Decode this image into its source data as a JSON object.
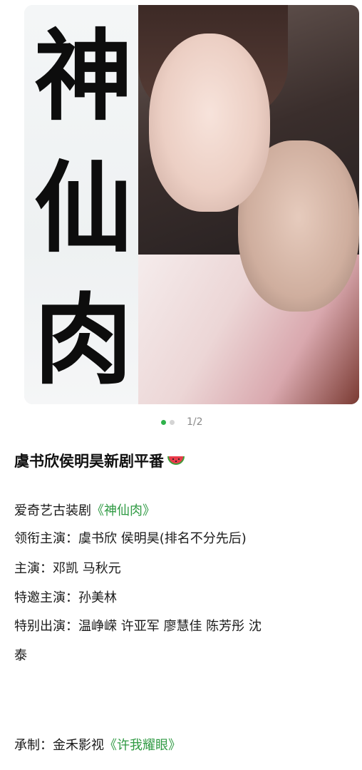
{
  "poster": {
    "calligraphy": [
      "神",
      "仙",
      "肉"
    ],
    "description": ""
  },
  "carousel": {
    "counter": "1/2",
    "current": 1,
    "total": 2
  },
  "post": {
    "title": "虞书欣侯明昊新剧平番",
    "title_emoji": "watermelon-icon",
    "lines": {
      "l1_prefix": "爱奇艺古装剧",
      "l1_link": "《神仙肉》",
      "l2": "领衔主演：虞书欣 侯明昊(排名不分先后)",
      "l3": "主演：邓凯 马秋元",
      "l4": "特邀主演：孙美林",
      "l5": "特别出演：温峥嵘 许亚军 廖慧佳 陈芳彤 沈",
      "l5b": "泰",
      "l6_prefix": "承制：金禾影视",
      "l6_link": "《许我耀眼》"
    }
  },
  "colors": {
    "link": "#2f9a43",
    "active_dot": "#2fb24b"
  }
}
